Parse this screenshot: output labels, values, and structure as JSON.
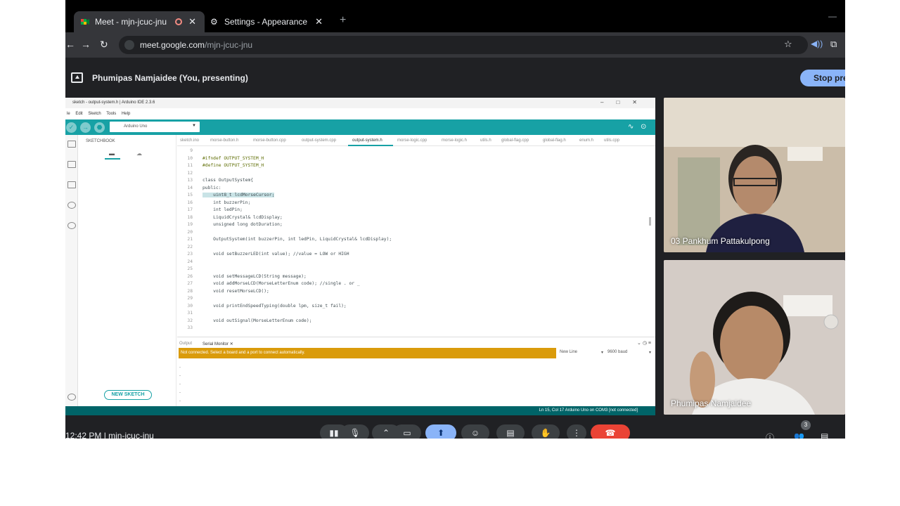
{
  "browser": {
    "tabs": [
      {
        "label": "Meet - mjn-jcuc-jnu"
      },
      {
        "label": "Settings - Appearance"
      }
    ],
    "newtab_glyph": "+",
    "url_host": "meet.google.com",
    "url_path": "/mjn-jcuc-jnu"
  },
  "presenting": {
    "text": "Phumipas Namjaidee (You, presenting)",
    "stop_label": "Stop pres"
  },
  "ide": {
    "title": "sketch - output-system.h | Arduino IDE 2.3.6",
    "menu": [
      "le",
      "Edit",
      "Sketch",
      "Tools",
      "Help"
    ],
    "board": "Arduino Uno",
    "sketchbook_title": "SKETCHBOOK",
    "new_sketch_label": "NEW SKETCH",
    "file_tabs": [
      "sketch.ino",
      "morse-button.h",
      "morse-button.cpp",
      "output-system.cpp",
      "output-system.h",
      "morse-logic.cpp",
      "morse-logic.h",
      "utils.h",
      "global-flag.cpp",
      "global-flag.h",
      "enum.h",
      "utils.cpp"
    ],
    "active_file": "output-system.h",
    "code_lines": [
      {
        "n": "9",
        "t": ""
      },
      {
        "n": "10",
        "t": "#ifndef OUTPUT_SYSTEM_H"
      },
      {
        "n": "11",
        "t": "#define OUTPUT_SYSTEM_H"
      },
      {
        "n": "12",
        "t": ""
      },
      {
        "n": "13",
        "t": "class OutputSystem{"
      },
      {
        "n": "14",
        "t": "public:"
      },
      {
        "n": "15",
        "t": "    uint8_t lcdMorseCursor;"
      },
      {
        "n": "16",
        "t": "    int buzzerPin;"
      },
      {
        "n": "17",
        "t": "    int ledPin;"
      },
      {
        "n": "18",
        "t": "    LiquidCrystal& lcdDisplay;"
      },
      {
        "n": "19",
        "t": "    unsigned long dotDuration;"
      },
      {
        "n": "20",
        "t": ""
      },
      {
        "n": "21",
        "t": "    OutputSystem(int buzzerPin, int ledPin, LiquidCrystal& lcdDisplay);"
      },
      {
        "n": "22",
        "t": ""
      },
      {
        "n": "23",
        "t": "    void setBuzzerLED(int value); //value = LOW or HIGH"
      },
      {
        "n": "24",
        "t": ""
      },
      {
        "n": "25",
        "t": ""
      },
      {
        "n": "26",
        "t": "    void setMessageLCD(String message);"
      },
      {
        "n": "27",
        "t": "    void addMorseLCD(MorseLetterEnum code); //single . or _"
      },
      {
        "n": "28",
        "t": "    void resetMorseLCD();"
      },
      {
        "n": "29",
        "t": ""
      },
      {
        "n": "30",
        "t": "    void printEndSpeedTyping(double lpm, size_t fail);"
      },
      {
        "n": "31",
        "t": ""
      },
      {
        "n": "32",
        "t": "    void outSignal(MorseLetterEnum code);"
      },
      {
        "n": "33",
        "t": ""
      }
    ],
    "bottom_tabs": {
      "output": "Output",
      "serial": "Serial Monitor"
    },
    "not_connected": "Not connected. Select a board and a port to connect automatically.",
    "line_ending": "New Line",
    "baud": "9600 baud",
    "status": "Ln 15, Col 17    Arduino Uno on COM3 [not connected]"
  },
  "participants": [
    {
      "name": "03 Pankhum Pattakulpong"
    },
    {
      "name": "Phumipas Namjaidee"
    }
  ],
  "meetbar": {
    "clock": "12:42 PM  |  mjn-jcuc-jnu",
    "people_count": "3"
  },
  "colors": {
    "arduino_teal": "#17a1a5",
    "warning": "#da9b0b",
    "meet_blue": "#8ab4f8",
    "hangup_red": "#ea4335"
  }
}
